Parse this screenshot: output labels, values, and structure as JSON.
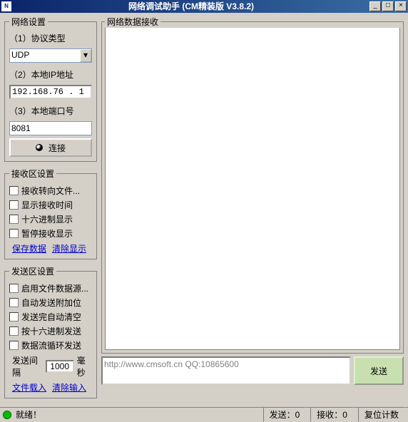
{
  "title": "网络调试助手  (CM精装版  V3.8.2)",
  "groups": {
    "net": "网络设置",
    "recv": "接收区设置",
    "send": "发送区设置",
    "netrecv": "网络数据接收"
  },
  "net": {
    "proto_label": "（1）协议类型",
    "proto_value": "UDP",
    "ip_label": "（2）本地IP地址",
    "ip_value": "192.168.76 . 1",
    "port_label": "（3）本地端口号",
    "port_value": "8081",
    "connect": "连接"
  },
  "recv": {
    "c1": "接收转向文件...",
    "c2": "显示接收时间",
    "c3": "十六进制显示",
    "c4": "暂停接收显示",
    "save": "保存数据",
    "clear": "清除显示"
  },
  "send": {
    "c1": "启用文件数据源...",
    "c2": "自动发送附加位",
    "c3": "发送完自动清空",
    "c4": "按十六进制发送",
    "c5": "数据流循环发送",
    "interval_lbl": "发送间隔",
    "interval_val": "1000",
    "interval_unit": "毫秒",
    "fileload": "文件载入",
    "clearinput": "清除输入",
    "box_text": "http://www.cmsoft.cn QQ:10865600",
    "sendbtn": "发送"
  },
  "status": {
    "ready": "就绪！",
    "sx": "发送：0",
    "rx": "接收：0",
    "reset": "复位计数"
  },
  "win": {
    "min": "_",
    "max": "□",
    "close": "×"
  }
}
